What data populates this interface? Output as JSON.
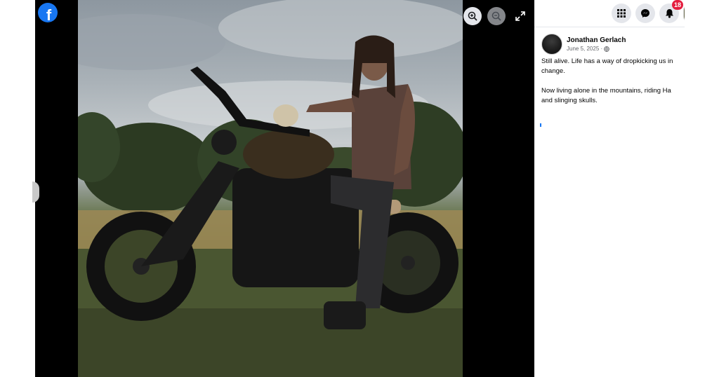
{
  "viewer": {
    "logo_letter": "f",
    "icons": [
      "facebook-logo-icon",
      "zoom-in-icon",
      "zoom-out-icon",
      "fullscreen-icon"
    ]
  },
  "header": {
    "icons": [
      "menu-grid-icon",
      "messenger-icon",
      "bell-icon"
    ],
    "notifications_count": "18"
  },
  "post": {
    "author": "Jonathan Gerlach",
    "date": "June 5, 2025 ·",
    "privacy_icon": "globe-icon",
    "text": "Still alive. Life has a way of dropkicking us in\nchange.\n\nNow living alone in the mountains, riding Ha\nand slinging skulls."
  },
  "colors": {
    "brand": "#1877f2",
    "badge": "#e41e3f",
    "viewer_bg": "#000000"
  }
}
